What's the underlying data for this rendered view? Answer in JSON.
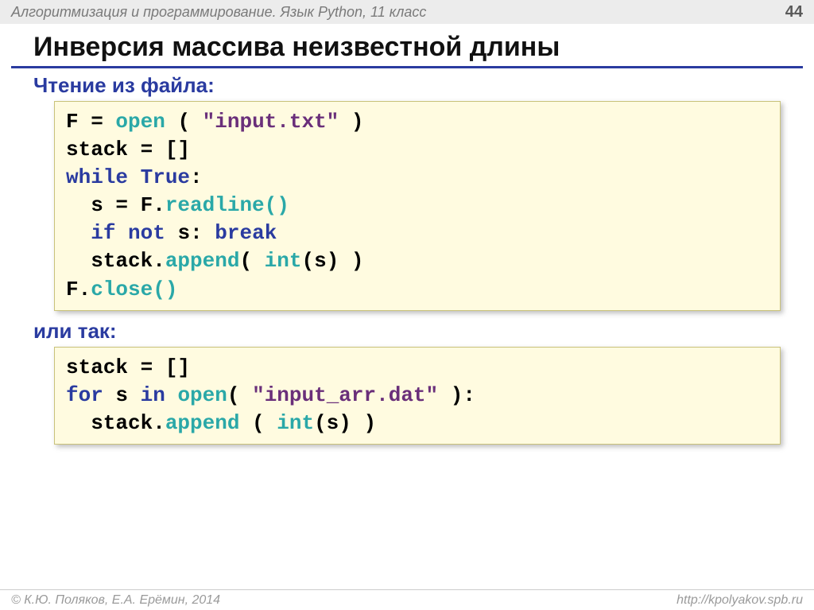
{
  "header": {
    "course": "Алгоритмизация и программирование. Язык Python, 11 класс",
    "page": "44"
  },
  "title": "Инверсия массива неизвестной длины",
  "section1": {
    "heading": "Чтение из файла:",
    "code": {
      "l1_a": "F = ",
      "l1_open": "open",
      "l1_b": " ( ",
      "l1_str": "\"input.txt\"",
      "l1_c": " )",
      "l2": "stack = []",
      "l3_a": "while",
      "l3_b": " ",
      "l3_true": "True",
      "l3_c": ":",
      "l4_a": "  s = F.",
      "l4_read": "readline()",
      "l5_a": "  ",
      "l5_if": "if",
      "l5_b": " ",
      "l5_not": "not",
      "l5_c": " s: ",
      "l5_break": "break",
      "l6_a": "  stack.",
      "l6_append": "append",
      "l6_b": "( ",
      "l6_int": "int",
      "l6_c": "(s) )",
      "l7_a": "F.",
      "l7_close": "close()"
    }
  },
  "section2": {
    "heading": "или так:",
    "code": {
      "l1": "stack = []",
      "l2_for": "for",
      "l2_a": " s ",
      "l2_in": "in",
      "l2_b": " ",
      "l2_open": "open",
      "l2_c": "( ",
      "l2_str": "\"input_arr.dat\"",
      "l2_d": " ):",
      "l3_a": "  stack.",
      "l3_append": "append",
      "l3_b": " ( ",
      "l3_int": "int",
      "l3_c": "(s) )"
    }
  },
  "footer": {
    "left": "© К.Ю. Поляков, Е.А. Ерёмин, 2014",
    "right": "http://kpolyakov.spb.ru"
  }
}
